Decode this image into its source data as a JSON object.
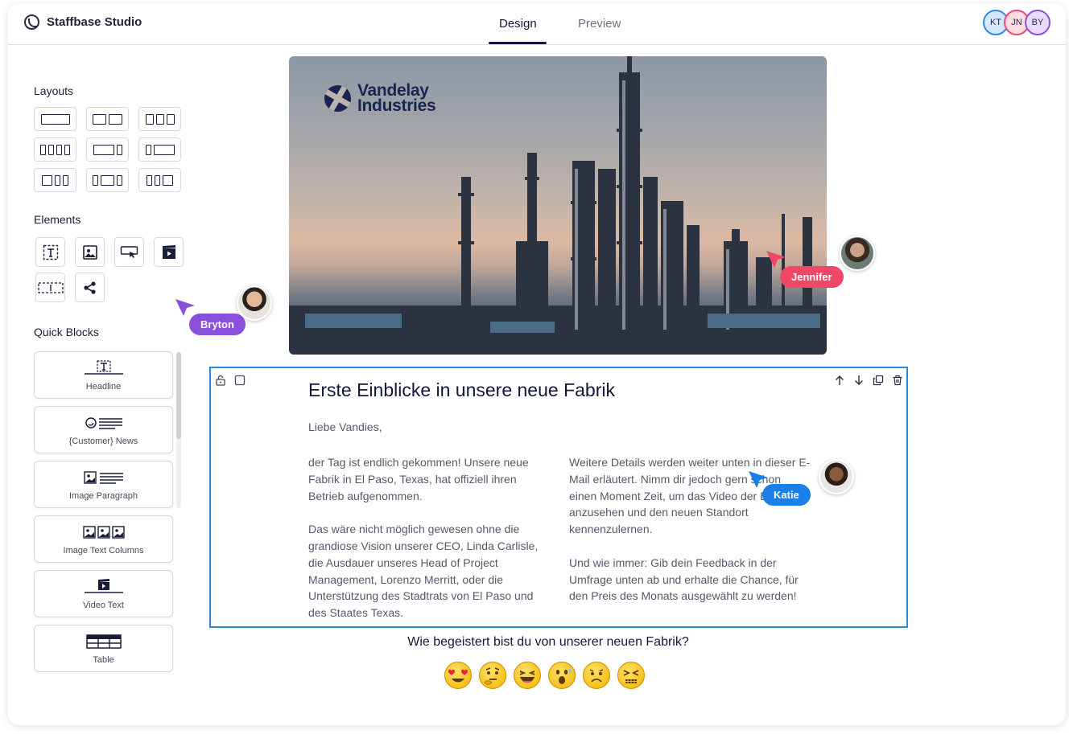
{
  "app": {
    "title": "Staffbase Studio",
    "tabs": [
      "Design",
      "Preview"
    ],
    "active_tab": "Design",
    "collaborators": [
      "KT",
      "JN",
      "BY"
    ]
  },
  "sidebar": {
    "layouts_title": "Layouts",
    "elements_title": "Elements",
    "quick_blocks_title": "Quick Blocks",
    "layouts": [
      "one-column",
      "two-columns",
      "three-columns",
      "four-columns",
      "wide-narrow",
      "narrow-wide",
      "two-plus-two",
      "narrow-wide-narrow",
      "two-plus-wide"
    ],
    "elements": [
      "text-element-icon",
      "image-element-icon",
      "button-element-icon",
      "video-element-icon",
      "spacer-element-icon",
      "social-element-icon"
    ],
    "quick_blocks": [
      {
        "label": "Headline",
        "icon": "headline-icon"
      },
      {
        "label": "{Customer} News",
        "icon": "news-icon"
      },
      {
        "label": "Image Paragraph",
        "icon": "image-paragraph-icon"
      },
      {
        "label": "Image Text Columns",
        "icon": "image-columns-icon"
      },
      {
        "label": "Video Text",
        "icon": "video-text-icon"
      },
      {
        "label": "Table",
        "icon": "table-icon"
      }
    ]
  },
  "hero": {
    "brand_line1": "Vandelay",
    "brand_line2": "Industries"
  },
  "article": {
    "title": "Erste Einblicke in unsere neue Fabrik",
    "greeting": "Liebe Vandies,",
    "col1": [
      "der Tag ist endlich gekommen! Unsere neue Fabrik in El Paso, Texas, hat offiziell ihren Betrieb aufgenommen.",
      "Das wäre nicht möglich gewesen ohne die grandiose Vision unserer CEO, Linda Carlisle, die Ausdauer unseres Head of Project Management, Lorenzo Merritt, oder die Unterstützung des Stadtrats von El Paso und des Staates Texas."
    ],
    "col2": [
      "Weitere Details werden weiter unten in dieser E-Mail erläutert. Nimm dir jedoch gern schon einen Moment Zeit, um das Video der Eröffnung anzusehen und den neuen Standort kennenzulernen.",
      "Und wie immer: Gib dein Feedback in der Umfrage unten ab und erhalte die Chance, für den Preis des Monats ausgewählt zu werden!"
    ]
  },
  "survey": {
    "question": "Wie begeistert bist du von unserer neuen Fabrik?",
    "options": [
      "heart-eyes",
      "thinking",
      "laughing",
      "surprised",
      "sad",
      "angry"
    ]
  },
  "cursors": {
    "bryton": {
      "name": "Bryton",
      "color": "#8a4fdb"
    },
    "jennifer": {
      "name": "Jennifer",
      "color": "#ef4866"
    },
    "katie": {
      "name": "Katie",
      "color": "#1a7fe8"
    }
  }
}
